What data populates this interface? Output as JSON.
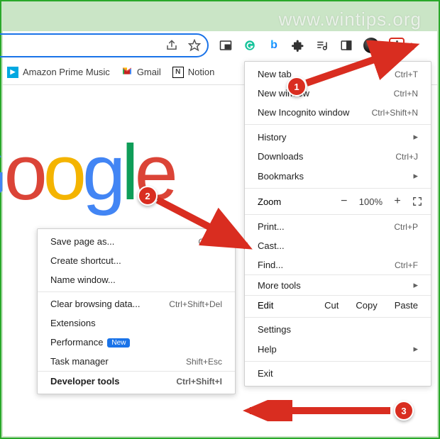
{
  "watermark": "www.wintips.org",
  "toolbar": {},
  "bookmarks": {
    "prime": "Amazon Prime Music",
    "gmail": "Gmail",
    "notion": "Notion"
  },
  "google_letters": [
    "G",
    "o",
    "o",
    "g",
    "l",
    "e"
  ],
  "main_menu": {
    "new_tab": "New tab",
    "new_tab_sc": "Ctrl+T",
    "new_window": "New window",
    "new_window_sc": "Ctrl+N",
    "incognito": "New Incognito window",
    "incognito_sc": "Ctrl+Shift+N",
    "history": "History",
    "downloads": "Downloads",
    "downloads_sc": "Ctrl+J",
    "bookmarks": "Bookmarks",
    "zoom_label": "Zoom",
    "zoom_value": "100%",
    "print": "Print...",
    "print_sc": "Ctrl+P",
    "cast": "Cast...",
    "find": "Find...",
    "find_sc": "Ctrl+F",
    "more_tools": "More tools",
    "edit_label": "Edit",
    "cut": "Cut",
    "copy": "Copy",
    "paste": "Paste",
    "settings": "Settings",
    "help": "Help",
    "exit": "Exit"
  },
  "sub_menu": {
    "save_page": "Save page as...",
    "save_page_sc": "Ctrl+S",
    "create_shortcut": "Create shortcut...",
    "name_window": "Name window...",
    "clear_data": "Clear browsing data...",
    "clear_data_sc": "Ctrl+Shift+Del",
    "extensions": "Extensions",
    "performance": "Performance",
    "new_badge": "New",
    "task_manager": "Task manager",
    "task_manager_sc": "Shift+Esc",
    "dev_tools": "Developer tools",
    "dev_tools_sc": "Ctrl+Shift+I"
  },
  "callouts": {
    "one": "1",
    "two": "2",
    "three": "3"
  }
}
